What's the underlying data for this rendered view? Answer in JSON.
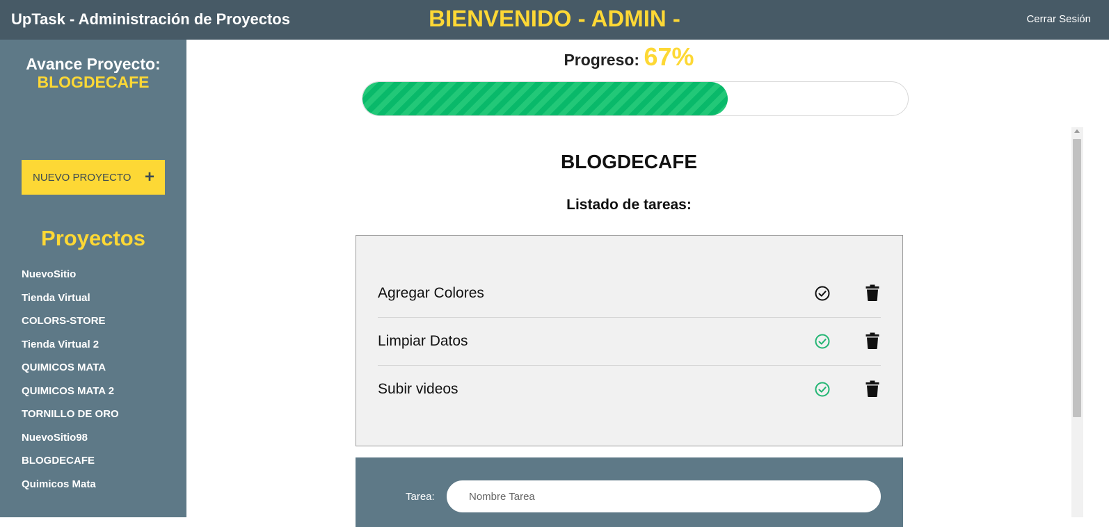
{
  "header": {
    "app_title": "UpTask - Administración de Proyectos",
    "welcome": "BIENVENIDO - ADMIN -",
    "logout_label": "Cerrar Sesión"
  },
  "sidebar": {
    "heading": "Avance Proyecto:",
    "current_project": "BLOGDECAFE",
    "new_project_label": "NUEVO PROYECTO",
    "new_project_icon": "plus-icon",
    "projects_title": "Proyectos",
    "projects": [
      "NuevoSitio",
      "Tienda Virtual",
      "COLORS-STORE",
      "Tienda Virtual 2",
      "QUIMICOS MATA",
      "QUIMICOS MATA 2",
      "TORNILLO DE ORO",
      "NuevoSitio98",
      "BLOGDECAFE",
      "Quimicos Mata"
    ]
  },
  "progress": {
    "label": "Progreso:",
    "value_text": "67%",
    "fraction": 0.67
  },
  "main": {
    "project_name": "BLOGDECAFE",
    "task_heading": "Listado de tareas:",
    "tasks": [
      {
        "name": "Agregar Colores",
        "completed": false,
        "status_icon": "check-circle-icon",
        "delete_icon": "trash-icon"
      },
      {
        "name": "Limpiar Datos",
        "completed": true,
        "status_icon": "check-circle-icon",
        "delete_icon": "trash-icon"
      },
      {
        "name": "Subir videos",
        "completed": true,
        "status_icon": "check-circle-icon",
        "delete_icon": "trash-icon"
      }
    ],
    "form": {
      "label": "Tarea:",
      "placeholder": "Nombre Tarea",
      "value": ""
    }
  },
  "colors": {
    "topbar": "#475a66",
    "sidebar": "#5e7987",
    "accent": "#fdd835",
    "progress_green": "#09b96a",
    "complete_icon": "#22b573",
    "pending_icon": "#111111"
  }
}
